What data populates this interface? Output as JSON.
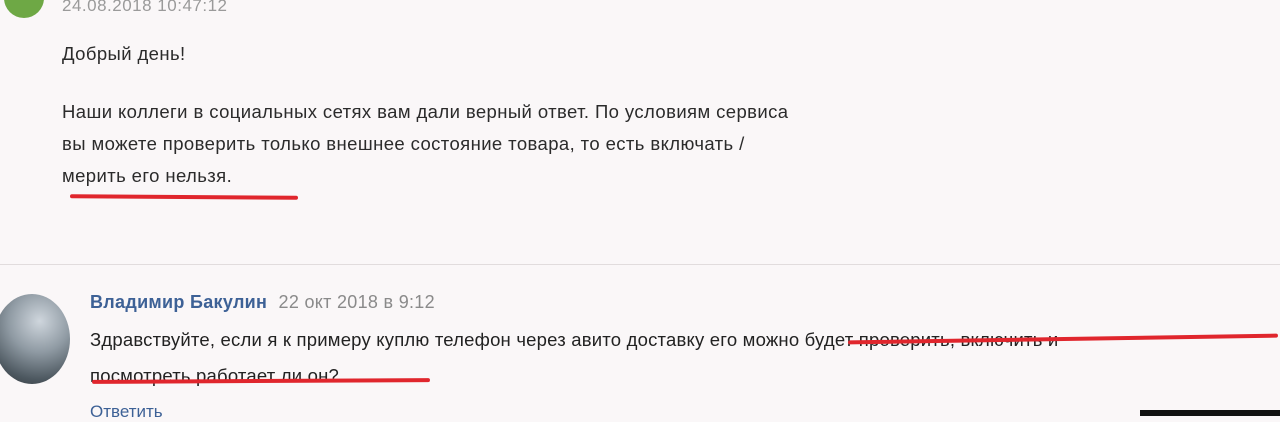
{
  "post": {
    "timestamp": "24.08.2018 10:47:12",
    "greeting": "Добрый день!",
    "lines": [
      "Наши коллеги в социальных сетях вам дали верный ответ. По условиям сервиса",
      "вы можете проверить только внешнее состояние товара, то есть включать /",
      "мерить его нельзя."
    ]
  },
  "comment": {
    "author": "Владимир Бакулин",
    "date": "22 окт 2018 в 9:12",
    "lines": [
      "Здравствуйте, если я к примеру куплю телефон через авито доставку его можно будет проверить, включить и",
      "посмотреть работает ли он?"
    ],
    "reply_label": "Ответить"
  },
  "colors": {
    "author_link": "#3d6196",
    "annotation_underline": "#e0262d",
    "avatar_green": "#6ea845"
  }
}
